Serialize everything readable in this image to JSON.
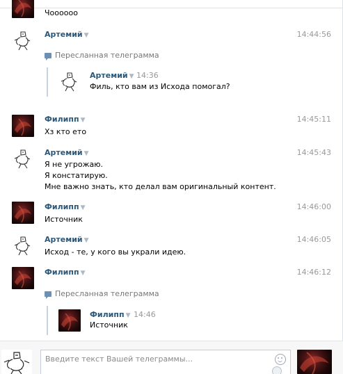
{
  "messages": [
    {
      "author": "",
      "time": "",
      "lines": [
        "Чоооооо"
      ]
    },
    {
      "author": "Артемий",
      "time": "14:44:56",
      "lines": []
    },
    {
      "author": "Филипп",
      "time": "14:45:11",
      "lines": [
        "Хз кто ето"
      ]
    },
    {
      "author": "Артемий",
      "time": "14:45:43",
      "lines": [
        "Я не угрожаю.",
        "Я констатирую.",
        "Мне важно знать, кто делал вам оригинальный контент."
      ]
    },
    {
      "author": "Филипп",
      "time": "14:46:00",
      "lines": [
        "Источник"
      ]
    },
    {
      "author": "Артемий",
      "time": "14:46:05",
      "lines": [
        "Исход - те, у кого вы украли идею."
      ]
    },
    {
      "author": "Филипп",
      "time": "14:46:12",
      "lines": []
    }
  ],
  "forwards": [
    {
      "label": "Пересланная телеграмма",
      "author": "Артемий",
      "time": "14:36",
      "text": "Филь, кто вам из Исхода помогал?"
    },
    {
      "label": "Пересланная телеграмма",
      "author": "Филипп",
      "time": "14:46",
      "text": "Источник"
    }
  ],
  "arrow_glyph": "▼",
  "composer": {
    "placeholder": "Введите текст Вашей телеграммы..."
  },
  "colors": {
    "author": "#2b587a",
    "time": "#999999",
    "forward_bar": "#c5d2df",
    "background": "#ffffff"
  }
}
